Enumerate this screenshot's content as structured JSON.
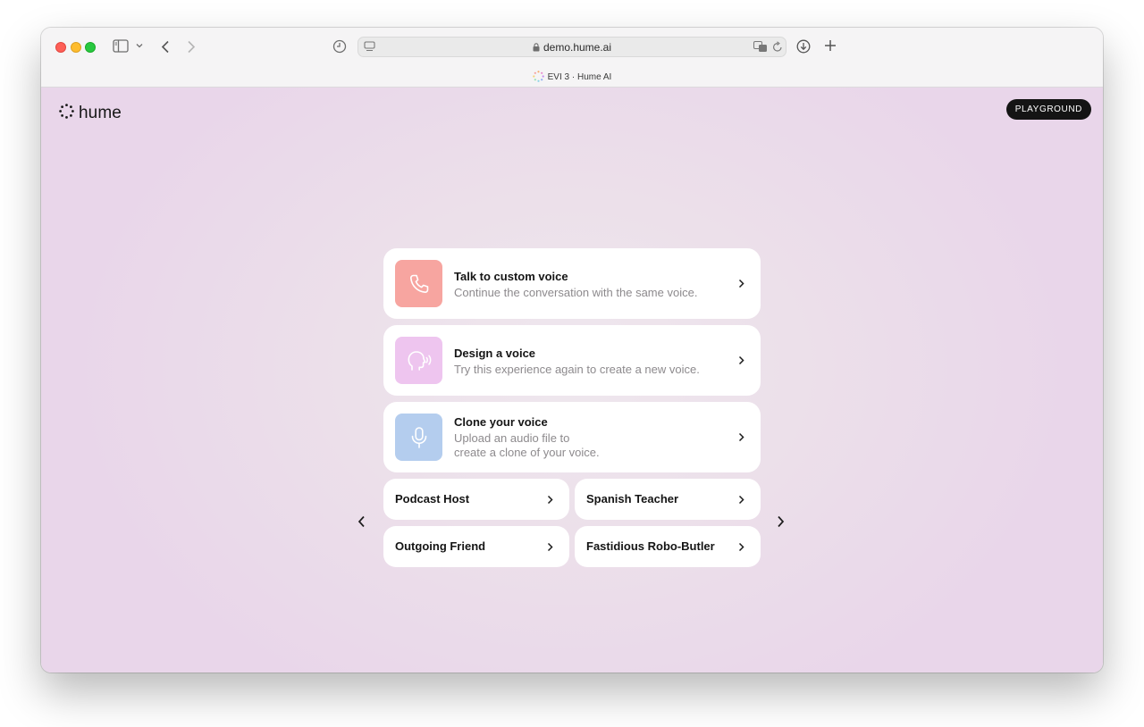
{
  "browser": {
    "url": "demo.hume.ai",
    "tab_title": "EVI 3 · Hume AI"
  },
  "header": {
    "logo_text": "hume",
    "playground_label": "PLAYGROUND"
  },
  "options": [
    {
      "title": "Talk to custom voice",
      "subtitle_lines": [
        "Continue the conversation with the same voice."
      ],
      "icon": "phone-icon",
      "color": "#f7a5a0"
    },
    {
      "title": "Design a voice",
      "subtitle_lines": [
        "Try this experience again to create a new voice."
      ],
      "icon": "speaking-head-icon",
      "color": "#eec5ef"
    },
    {
      "title": "Clone your voice",
      "subtitle_lines": [
        "Upload an audio file to",
        "create a clone of your voice."
      ],
      "icon": "microphone-icon",
      "color": "#b4cdee"
    }
  ],
  "presets": [
    {
      "label": "Podcast Host"
    },
    {
      "label": "Spanish Teacher"
    },
    {
      "label": "Outgoing Friend"
    },
    {
      "label": "Fastidious Robo-Butler"
    }
  ]
}
